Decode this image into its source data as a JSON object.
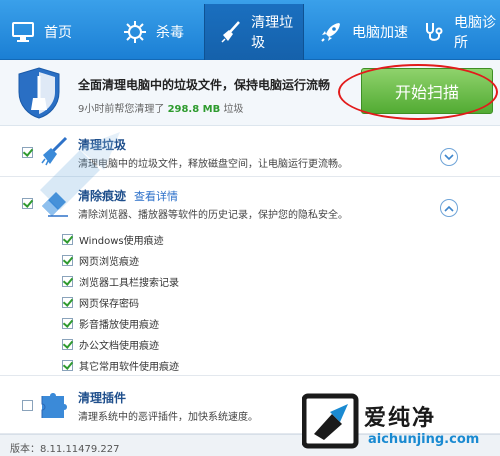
{
  "nav": {
    "tabs": [
      {
        "label": "首页",
        "icon": "monitor-icon"
      },
      {
        "label": "杀毒",
        "icon": "antivirus-icon"
      },
      {
        "label": "清理垃圾",
        "icon": "broom-icon",
        "active": true
      },
      {
        "label": "电脑加速",
        "icon": "rocket-icon"
      },
      {
        "label": "电脑诊所",
        "icon": "stethoscope-icon"
      }
    ]
  },
  "summary": {
    "title": "全面清理电脑中的垃圾文件，保持电脑运行流畅",
    "sub_prefix": "9小时前帮您清理了",
    "sub_amount": "298.8 MB",
    "sub_suffix": "垃圾",
    "scan_button": "开始扫描"
  },
  "sections": {
    "junk": {
      "title": "清理垃圾",
      "desc": "清理电脑中的垃圾文件，释放磁盘空间，让电脑运行更流畅。",
      "checked": true
    },
    "traces": {
      "title": "清除痕迹",
      "detail_link": "查看详情",
      "desc": "清除浏览器、播放器等软件的历史记录，保护您的隐私安全。",
      "checked": true,
      "items": [
        "Windows使用痕迹",
        "网页浏览痕迹",
        "浏览器工具栏搜索记录",
        "网页保存密码",
        "影音播放使用痕迹",
        "办公文档使用痕迹",
        "其它常用软件使用痕迹"
      ]
    },
    "plugins": {
      "title": "清理插件",
      "desc": "清理系统中的恶评插件，加快系统速度。",
      "checked": false
    }
  },
  "footer": {
    "version": "版本：8.11.11479.227"
  },
  "watermark": {
    "brand": "爱纯净",
    "url": "aichunjing.com"
  },
  "colors": {
    "nav_blue": "#1b7fd4",
    "scan_green": "#52ab33",
    "annotation_red": "#e21b1b",
    "link_blue": "#2b6fc9"
  }
}
